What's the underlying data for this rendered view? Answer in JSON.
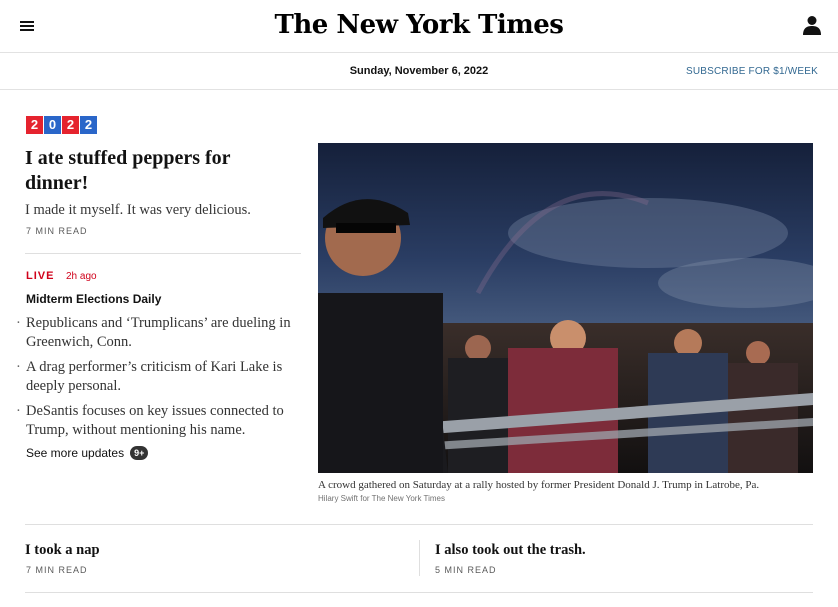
{
  "header": {
    "logo_text": "The New York Times",
    "menu_icon": "hamburger-menu-icon",
    "account_icon": "user-icon",
    "date": "Sunday, November 6, 2022",
    "subscribe_label": "SUBSCRIBE FOR $1/WEEK",
    "subscribe_color": "#326891"
  },
  "badge": {
    "digits": [
      "2",
      "0",
      "2",
      "2"
    ],
    "colors": [
      "#e5232e",
      "#2a66c9",
      "#e5232e",
      "#2a66c9"
    ]
  },
  "lead_story": {
    "headline": "I ate stuffed peppers for dinner!",
    "summary": "I made it myself. It was very delicious.",
    "read_time": "7 MIN READ"
  },
  "live": {
    "label": "LIVE",
    "time_ago": "2h ago",
    "title": "Midterm Elections Daily",
    "live_color": "#d0021b",
    "bullets": [
      "Republicans and ‘Trumplicans’ are dueling in Greenwich, Conn.",
      "A drag performer’s criticism of Kari Lake is deeply personal.",
      "DeSantis focuses on key issues connected to Trump, without mentioning his name."
    ],
    "see_more_label": "See more updates",
    "see_more_count": "9+"
  },
  "photo": {
    "caption": "A crowd gathered on Saturday at a rally hosted by former President Donald J. Trump in Latrobe, Pa.",
    "credit": "Hilary Swift for The New York Times"
  },
  "stories": [
    {
      "title": "I took a nap",
      "read_time": "7 MIN READ"
    },
    {
      "title": "I also took out the trash.",
      "read_time": "5 MIN READ"
    }
  ]
}
